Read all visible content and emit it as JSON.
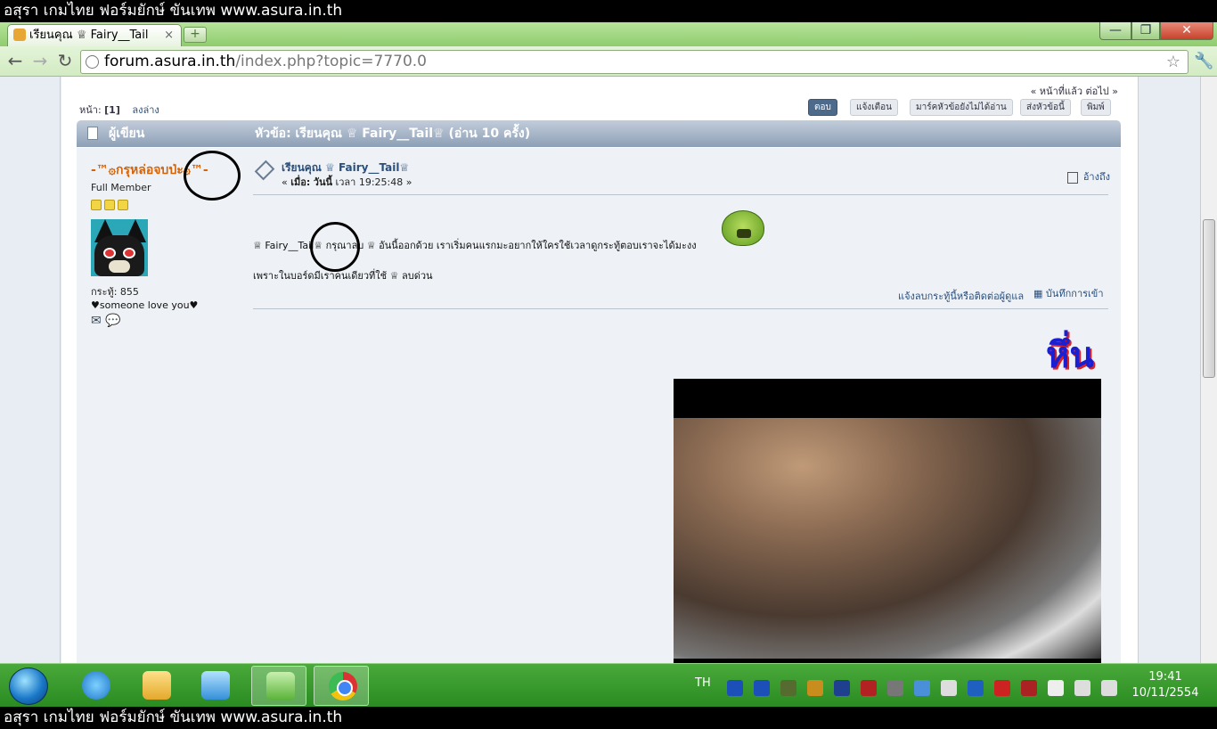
{
  "banner": {
    "text": "อสุรา เกมไทย ฟอร์มยักษ์ ขันเทพ www.asura.in.th"
  },
  "browser": {
    "tab": {
      "title": "เรียนคุณ ♕ Fairy__Tail"
    },
    "new_tab": "+",
    "window": {
      "minimize": "—",
      "maximize": "❐",
      "close": "✕"
    },
    "nav": {
      "back": "←",
      "forward": "→",
      "reload": "↻",
      "star": "☆",
      "wrench": "🔧"
    },
    "url": {
      "host": "forum.asura.in.th",
      "path": "/index.php?topic=7770.0"
    }
  },
  "forum": {
    "prev_next": "« หน้าที่แล้ว ต่อไป »",
    "pages_label": "หน้า:",
    "current_page": "[1]",
    "go_down": "ลงล่าง",
    "buttons": {
      "reply": "ตอบ",
      "notify": "แจ้งเตือน",
      "mark_unread": "มาร์คหัวข้อยังไม่ได้อ่าน",
      "send": "ส่งหัวข้อนี้",
      "print": "พิมพ์"
    },
    "header": {
      "author": "ผู้เขียน",
      "topic": "หัวข้อ: เรียนคุณ ♕ Fairy__Tail♕ (อ่าน 10 ครั้ง)"
    },
    "poster": {
      "name": "-™۞กรุหล่อจบป่ะ۞™-",
      "rank": "Full Member",
      "stars": 3,
      "posts": "กระทู้: 855",
      "personal_text": "♥someone love you♥",
      "icons": [
        "email-icon",
        "profile-icon"
      ]
    },
    "post": {
      "subject": "เรียนคุณ ♕ Fairy__Tail♕",
      "time_prefix": "«",
      "time_label": "เมื่อ:",
      "time_day": "วันนี้",
      "time_value": "เวลา 19:25:48 »",
      "quote": "อ้างถึง",
      "body_line1": "♕ Fairy__Tail♕  กรุณาลบ ♕ อันนี้ออกด้วย เราเริ่มคนแรกมะอยากให้ใครใช้เวลาดูกระทู้ตอบเราจะได้มะงง",
      "body_line2": "เพราะในบอร์ดมีเราคนเดียวที่ใช้ ♕ ลบด่วน",
      "report": "แจ้งลบกระทู้นี้หรือติดต่อผู้ดูแล",
      "logged": "บันทึกการเข้า",
      "big_text": "หึ่น"
    }
  },
  "taskbar": {
    "language": "TH",
    "time": "19:41",
    "date": "10/11/2554",
    "tray_colors": [
      "#1c4fb8",
      "#1c4fb8",
      "#556b2f",
      "#c98d1e",
      "#1f3f8f",
      "#b22222",
      "#777777",
      "#4a90d9",
      "#dddddd",
      "#1f5fbf",
      "#cc2222",
      "#aa2222",
      "#eeeeee",
      "#dddddd",
      "#dddddd"
    ]
  }
}
